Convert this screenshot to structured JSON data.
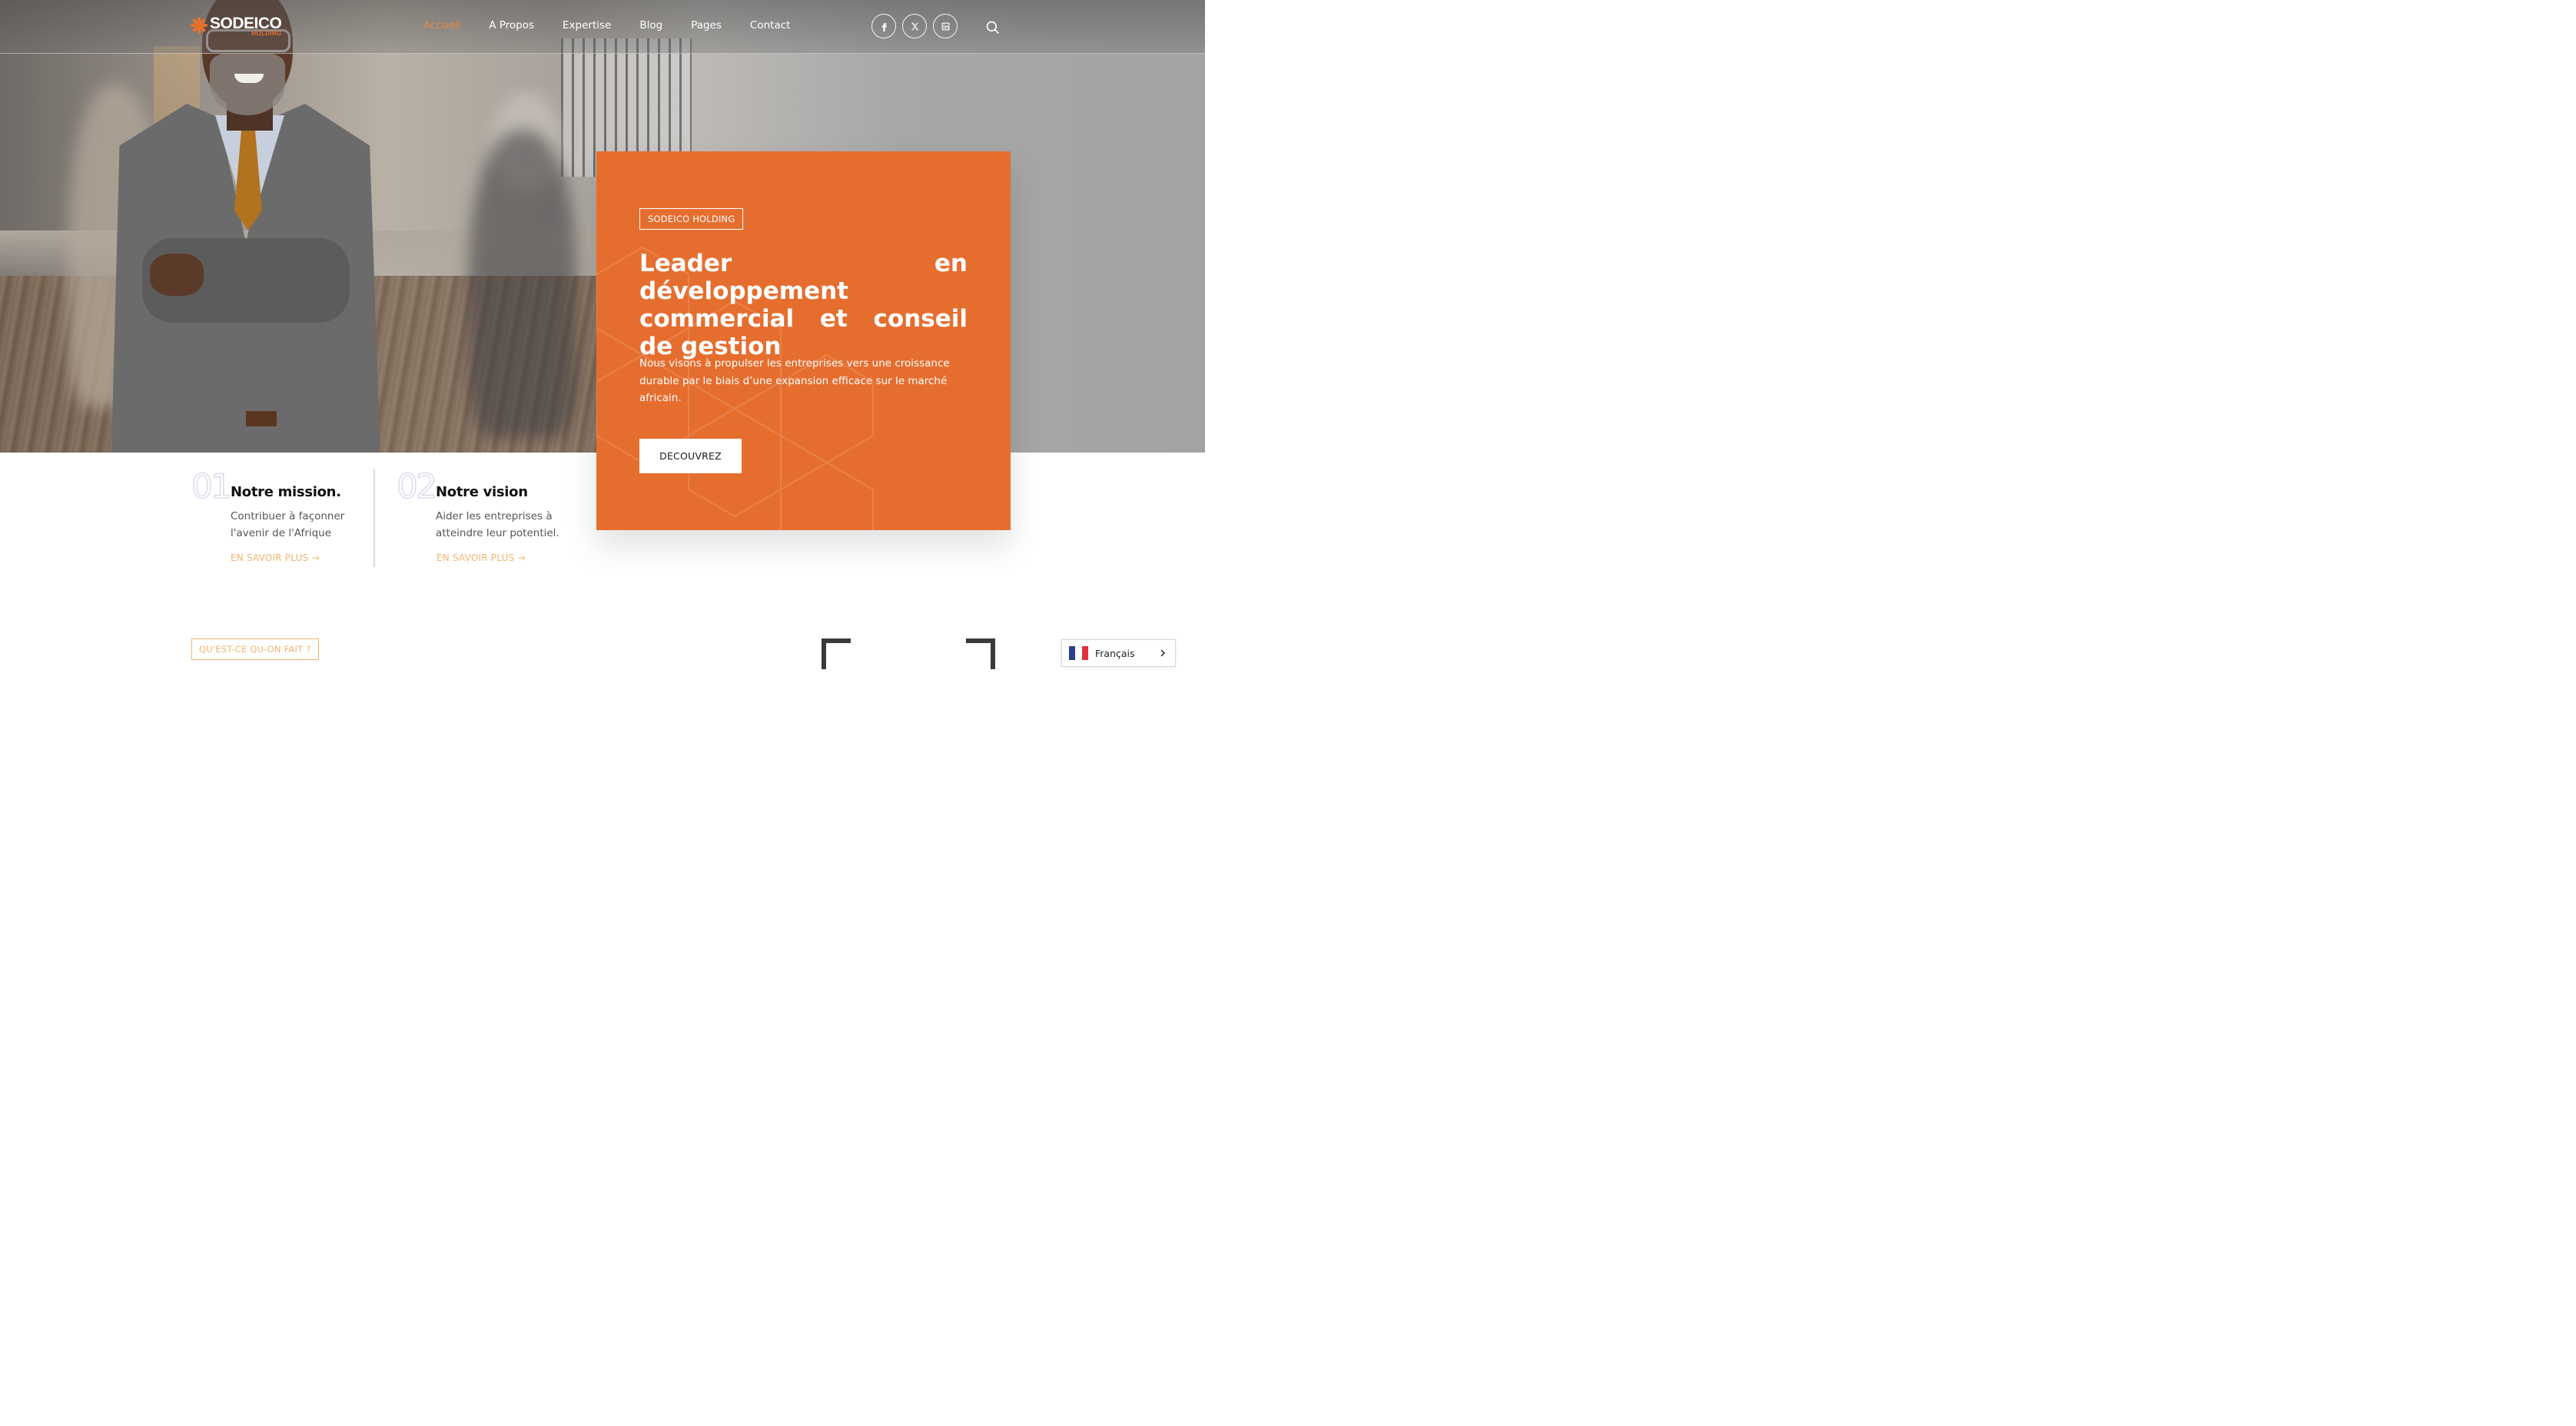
{
  "brand": {
    "name": "SODEICO",
    "sub": "HOLDING",
    "accent": "#e56e2f"
  },
  "nav": [
    {
      "label": "Accueil",
      "active": true
    },
    {
      "label": "A Propos",
      "active": false
    },
    {
      "label": "Expertise",
      "active": false
    },
    {
      "label": "Blog",
      "active": false
    },
    {
      "label": "Pages",
      "active": false
    },
    {
      "label": "Contact",
      "active": false
    }
  ],
  "socials": [
    "facebook-icon",
    "x-twitter-icon",
    "linkedin-icon"
  ],
  "hero": {
    "tag": "SODEICO HOLDING",
    "title": "Leader en développement commercial et conseil de gestion",
    "description": "Nous visons à propulser les entreprises vers une croissance durable par le biais d’une expansion efficace sur le marché africain.",
    "cta": "DECOUVREZ"
  },
  "mission": {
    "num": "01",
    "title": "Notre mission.",
    "line1": "Contribuer à façonner",
    "line2": "l'avenir de l'Afrique",
    "link": "EN SAVOIR PLUS →"
  },
  "vision": {
    "num": "02",
    "title": "Notre vision",
    "line1": "Aider les entreprises à",
    "line2": "atteindre leur potentiel.",
    "link": "EN SAVOIR PLUS →"
  },
  "section": {
    "tag": "QU'EST-CE QU-ON FAIT ?"
  },
  "language": {
    "label": "Français"
  }
}
